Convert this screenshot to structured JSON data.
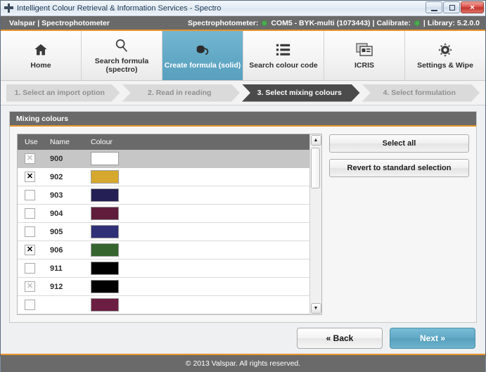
{
  "window": {
    "title": "Intelligent Colour Retrieval & Information Services - Spectro",
    "app_icon": "app-icon",
    "controls": {
      "minimize": "–",
      "maximize": "□",
      "close": "✕"
    }
  },
  "statusbar": {
    "brand": "Valspar | Spectrophotometer",
    "spectrophotometer_label": "Spectrophotometer:",
    "device": "COM5 - BYK-multi (1073443)",
    "separator1": "|",
    "calibrate_label": "Calibrate:",
    "separator2": "|",
    "library": "Library: 5.2.0.0",
    "status_dot_color": "#4caf50",
    "accent_color": "#e8932a"
  },
  "nav": {
    "items": [
      {
        "label": "Home",
        "icon": "home-icon",
        "active": false
      },
      {
        "label": "Search formula (spectro)",
        "icon": "magnifier-icon",
        "active": false
      },
      {
        "label": "Create formula (solid)",
        "icon": "paint-pour-icon",
        "active": true
      },
      {
        "label": "Search colour code",
        "icon": "list-icon",
        "active": false
      },
      {
        "label": "ICRIS",
        "icon": "window-card-icon",
        "active": false
      },
      {
        "label": "Settings & Wipe",
        "icon": "gear-icon",
        "active": false
      }
    ]
  },
  "stepper": {
    "steps": [
      {
        "label": "1. Select an import option",
        "active": false
      },
      {
        "label": "2. Read in reading",
        "active": false
      },
      {
        "label": "3. Select mixing colours",
        "active": true
      },
      {
        "label": "4. Select formulation",
        "active": false
      }
    ]
  },
  "panel": {
    "title": "Mixing colours",
    "columns": [
      "Use",
      "Name",
      "Colour"
    ],
    "rows": [
      {
        "use": "checked-disabled",
        "name": "900",
        "colour": "#ffffff",
        "selected": true
      },
      {
        "use": "checked",
        "name": "902",
        "colour": "#d6a82e",
        "selected": false
      },
      {
        "use": "unchecked",
        "name": "903",
        "colour": "#241f54",
        "selected": false
      },
      {
        "use": "unchecked",
        "name": "904",
        "colour": "#5f1d3b",
        "selected": false
      },
      {
        "use": "unchecked",
        "name": "905",
        "colour": "#2f3075",
        "selected": false
      },
      {
        "use": "checked",
        "name": "906",
        "colour": "#36642f",
        "selected": false
      },
      {
        "use": "unchecked",
        "name": "911",
        "colour": "#000000",
        "selected": false
      },
      {
        "use": "checked-disabled",
        "name": "912",
        "colour": "#000000",
        "selected": false
      },
      {
        "use": "unchecked",
        "name": "",
        "colour": "#6b1e42",
        "selected": false
      }
    ],
    "scrollbar": {
      "up": "▲",
      "down": "▼"
    }
  },
  "side_buttons": {
    "select_all": "Select all",
    "revert": "Revert to standard selection"
  },
  "actions": {
    "back": "« Back",
    "next": "Next »"
  },
  "footer": {
    "copyright": "© 2013 Valspar. All rights reserved."
  }
}
